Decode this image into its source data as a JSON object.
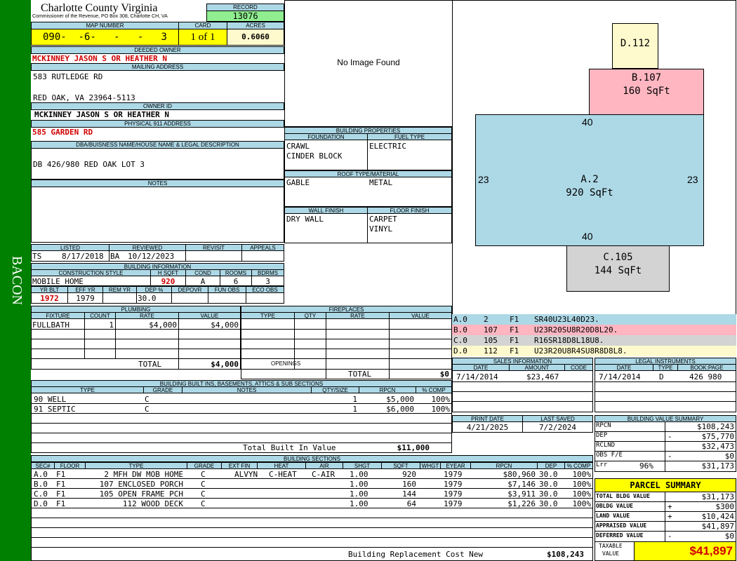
{
  "side_label": "BACON",
  "county": "Charlotte County Virginia",
  "commissioner": "Commissioner of the Revenue, PO Box 308, Charlotte CH, VA",
  "record_label": "RECORD",
  "record": "13076",
  "map_number_label": "MAP NUMBER",
  "map_number": "090-  -6-   -   -   3",
  "card_label": "CARD",
  "card": "1 of 1",
  "acres_label": "ACRES",
  "acres": "0.6060",
  "deeded_owner_label": "DEEDED OWNER",
  "deeded_owner": "MCKINNEY JASON S OR HEATHER N",
  "mailing_label": "MAILING ADDRESS",
  "mailing_line1": "583 RUTLEDGE RD",
  "mailing_line2": "RED OAK, VA 23964-5113",
  "owner_id_label": "OWNER ID",
  "owner_id": "MCKINNEY JASON S OR HEATHER N",
  "physical_label": "PHYSICAL 911 ADDRESS",
  "physical": "585 GARDEN RD",
  "dba_label": "DBA/BUISNESS NAME/HOUSE NAME & LEGAL DESCRIPTION",
  "legal": "DB 426/980 RED OAK LOT 3",
  "notes_label": "NOTES",
  "no_image": "No Image Found",
  "building_props": {
    "title": "BUILDING PROPERTIES",
    "foundation_label": "FOUNDATION",
    "fuel_label": "FUEL TYPE",
    "foundation1": "CRAWL",
    "foundation2": "CINDER BLOCK",
    "fuel": "ELECTRIC",
    "roof_label": "ROOF TYPE/MATERIAL",
    "roof_type": "GABLE",
    "roof_material": "METAL",
    "wall_label": "WALL FINISH",
    "floor_label": "FLOOR FINISH",
    "wall": "DRY WALL",
    "floor1": "CARPET",
    "floor2": "VINYL"
  },
  "listing": {
    "listed_label": "LISTED",
    "reviewed_label": "REVIEWED",
    "revisit_label": "REVISIT",
    "appeals_label": "APPEALS",
    "listed_by": "TS",
    "listed_date": "8/17/2018",
    "reviewed_by": "BA",
    "reviewed_date": "10/12/2023"
  },
  "building_info": {
    "title": "BUILDING INFORMATION",
    "style_label": "CONSTRUCTION STYLE",
    "hsqft_label": "H SQFT",
    "cond_label": "COND",
    "rooms_label": "ROOMS",
    "bdrms_label": "BDRMS",
    "style": "MOBILE HOME",
    "hsqft": "920",
    "cond": "A",
    "rooms": "6",
    "bdrms": "3",
    "yrblt_label": "YR BLT",
    "effyr_label": "EFF YR",
    "remyr_label": "REM YR",
    "dep_label": "DEP %",
    "depovr_label": "DEPOVR",
    "funobs_label": "FUN OBS",
    "ecoobs_label": "ECO OBS",
    "yrblt": "1972",
    "effyr": "1979",
    "dep": "30.0"
  },
  "plumbing": {
    "title": "PLUMBING",
    "fixture_label": "FIXTURE",
    "count_label": "COUNT",
    "rate_label": "RATE",
    "value_label": "VALUE",
    "fixture": "FULLBATH",
    "count": "1",
    "rate": "$4,000",
    "value": "$4,000",
    "total_label": "TOTAL",
    "total": "$4,000"
  },
  "fireplaces": {
    "title": "FIREPLACES",
    "type_label": "TYPE",
    "qty_label": "QTY",
    "rate_label": "RATE",
    "value_label": "VALUE",
    "openings_label": "OPENINGS",
    "total_label": "TOTAL",
    "total": "$0"
  },
  "sketch": {
    "d_label": "D.112",
    "b_label": "B.107",
    "b_area": "160 SqFt",
    "a_label": "A.2",
    "a_area": "920 SqFt",
    "c_label": "C.105",
    "c_area": "144 SqFt",
    "top": "40",
    "bottom": "40",
    "left": "23",
    "right": "23"
  },
  "sketch_codes": [
    {
      "c1": "A.0",
      "c2": "2",
      "c3": "F1",
      "c4": "SR40U23L40D23.",
      "color": "#add8e6"
    },
    {
      "c1": "B.0",
      "c2": "107",
      "c3": "F1",
      "c4": "U23R20SU8R20D8L20.",
      "color": "#ffb6c1"
    },
    {
      "c1": "C.0",
      "c2": "105",
      "c3": "F1",
      "c4": "R16SR18D8L18U8.",
      "color": "#d3d3d3"
    },
    {
      "c1": "D.0",
      "c2": "112",
      "c3": "F1",
      "c4": "U23R20U8R4SU8R8D8L8.",
      "color": "#fffacd"
    }
  ],
  "sales": {
    "title": "SALES INFORMATION",
    "date_label": "DATE",
    "amount_label": "AMOUNT",
    "code_label": "CODE",
    "date": "7/14/2014",
    "amount": "$23,467"
  },
  "legal_inst": {
    "title": "LEGAL INSTRUMENTS",
    "date_label": "DATE",
    "type_label": "TYPE",
    "book_label": "BOOK:PAGE",
    "date": "7/14/2014",
    "type": "D",
    "book": "426 980"
  },
  "print": {
    "print_label": "PRINT DATE",
    "saved_label": "LAST SAVED",
    "print_date": "4/21/2025",
    "saved_date": "7/2/2024"
  },
  "bvs": {
    "title": "BUILDING VALUE SUMMARY",
    "rows": [
      {
        "label": "RPCN",
        "sign": "",
        "value": "$108,243"
      },
      {
        "label": "DEP",
        "sign": "-",
        "value": "$75,770"
      },
      {
        "label": "RCLND",
        "sign": "",
        "value": "$32,473"
      },
      {
        "label": "OBS F/E",
        "sign": "-",
        "value": "$0"
      },
      {
        "label": "Lrr",
        "sign": "96%",
        "value": "$31,173"
      }
    ]
  },
  "parcel": {
    "title": "PARCEL SUMMARY",
    "rows": [
      {
        "label": "TOTAL BLDG VALUE",
        "sign": "",
        "value": "$31,173"
      },
      {
        "label": "OBLDG VALUE",
        "sign": "+",
        "value": "$300"
      },
      {
        "label": "LAND VALUE",
        "sign": "+",
        "value": "$10,424"
      },
      {
        "label": "APPRAISED VALUE",
        "sign": "",
        "value": "$41,897"
      },
      {
        "label": "DEFERRED VALUE",
        "sign": "-",
        "value": "$0"
      }
    ],
    "taxable_label1": "TAXABLE",
    "taxable_label2": "VALUE",
    "taxable": "$41,897"
  },
  "builtins": {
    "title": "BUILDING BUILT INS, BASEMENTS, ATTICS & SUB SECTIONS",
    "type_label": "TYPE",
    "grade_label": "GRADE",
    "notes_label": "NOTES",
    "qty_label": "QTY/SIZE",
    "rpcn_label": "RPCN",
    "comp_label": "% COMP",
    "rows": [
      {
        "type": "90 WELL",
        "grade": "C",
        "qty": "1",
        "rpcn": "$5,000",
        "comp": "100%"
      },
      {
        "type": "91 SEPTIC",
        "grade": "C",
        "qty": "1",
        "rpcn": "$6,000",
        "comp": "100%"
      }
    ],
    "total_label": "Total Built In Value",
    "total": "$11,000"
  },
  "sections": {
    "title": "BUILDING SECTIONS",
    "h_sec": "SEC#",
    "h_floor": "FLOOR",
    "h_type": "TYPE",
    "h_grade": "GRADE",
    "h_extfin": "EXT FIN",
    "h_heat": "HEAT",
    "h_air": "AIR",
    "h_shgt": "SHGT",
    "h_sqft": "SQFT",
    "h_whgt": "WHGT",
    "h_eyear": "EYEAR",
    "h_rpcn": "RPCN",
    "h_dep": "DEP",
    "h_comp": "% COMP",
    "rows": [
      {
        "sec": "A.0",
        "floor": "F1",
        "type": "2 MFH DW MOB HOME",
        "grade": "C",
        "extfin": "ALVYN",
        "heat": "C-HEAT",
        "air": "C-AIR",
        "shgt": "1.00",
        "sqft": "920",
        "eyear": "1979",
        "rpcn": "$80,960",
        "dep": "30.0",
        "comp": "100%"
      },
      {
        "sec": "B.0",
        "floor": "F1",
        "type": "107 ENCLOSED PORCH",
        "grade": "C",
        "extfin": "",
        "heat": "",
        "air": "",
        "shgt": "1.00",
        "sqft": "160",
        "eyear": "1979",
        "rpcn": "$7,146",
        "dep": "30.0",
        "comp": "100%"
      },
      {
        "sec": "C.0",
        "floor": "F1",
        "type": "105 OPEN FRAME PCH",
        "grade": "C",
        "extfin": "",
        "heat": "",
        "air": "",
        "shgt": "1.00",
        "sqft": "144",
        "eyear": "1979",
        "rpcn": "$3,911",
        "dep": "30.0",
        "comp": "100%"
      },
      {
        "sec": "D.0",
        "floor": "F1",
        "type": "112 WOOD DECK",
        "grade": "C",
        "extfin": "",
        "heat": "",
        "air": "",
        "shgt": "1.00",
        "sqft": "64",
        "eyear": "1979",
        "rpcn": "$1,226",
        "dep": "30.0",
        "comp": "100%"
      }
    ],
    "brcn_label": "Building Replacement Cost New",
    "brcn": "$108,243"
  }
}
